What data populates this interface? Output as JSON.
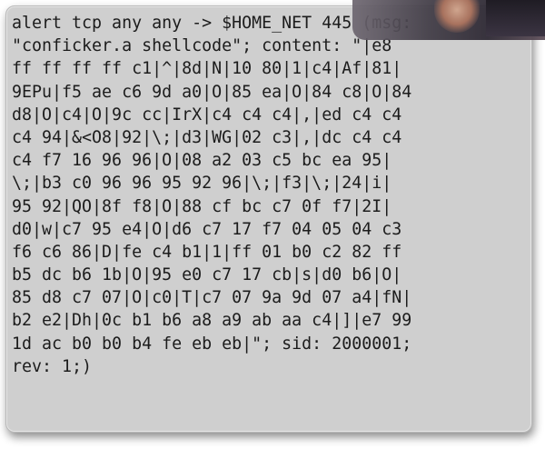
{
  "snort_rule": {
    "lines": [
      "alert tcp any any -> $HOME_NET 445 (msg:",
      "\"conficker.a shellcode\"; content: \"|e8",
      "ff ff ff ff c1|^|8d|N|10 80|1|c4|Af|81|",
      "9EPu|f5 ae c6 9d a0|O|85 ea|O|84 c8|O|84",
      "d8|O|c4|O|9c cc|IrX|c4 c4 c4|,|ed c4 c4",
      "c4 94|&<O8|92|\\;|d3|WG|02 c3|,|dc c4 c4",
      "c4 f7 16 96 96|O|08 a2 03 c5 bc ea 95|",
      "\\;|b3 c0 96 96 95 92 96|\\;|f3|\\;|24|i|",
      "95 92|QO|8f f8|O|88 cf bc c7 0f f7|2I|",
      "d0|w|c7 95 e4|O|d6 c7 17 f7 04 05 04 c3",
      "f6 c6 86|D|fe c4 b1|1|ff 01 b0 c2 82 ff",
      "b5 dc b6 1b|O|95 e0 c7 17 cb|s|d0 b6|O|",
      "85 d8 c7 07|O|c0|T|c7 07 9a 9d 07 a4|fN|",
      "b2 e2|Dh|0c b1 b6 a8 a9 ab aa c4|]|e7 99",
      "1d ac b0 b0 b4 fe eb eb|\"; sid: 2000001;",
      "rev: 1;)"
    ]
  }
}
